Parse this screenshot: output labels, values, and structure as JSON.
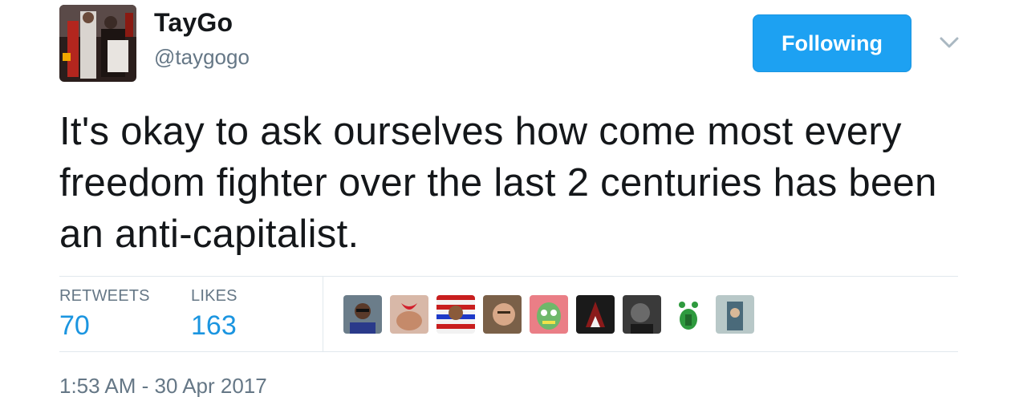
{
  "author": {
    "display_name": "TayGo",
    "handle": "@taygogo"
  },
  "follow_button": {
    "label": "Following"
  },
  "tweet": {
    "text": "It's okay to ask ourselves how come most every freedom fighter over the last 2 centuries has been an anti-capitalist."
  },
  "stats": {
    "retweets_label": "RETWEETS",
    "retweets_value": "70",
    "likes_label": "LIKES",
    "likes_value": "163"
  },
  "timestamp": "1:53 AM - 30 Apr 2017",
  "colors": {
    "accent": "#1da1f2",
    "stat_value": "#1b95e0",
    "muted": "#657786",
    "text": "#14171a",
    "divider": "#e1e8ed"
  },
  "icons": {
    "menu_caret": "chevron-down-icon"
  }
}
